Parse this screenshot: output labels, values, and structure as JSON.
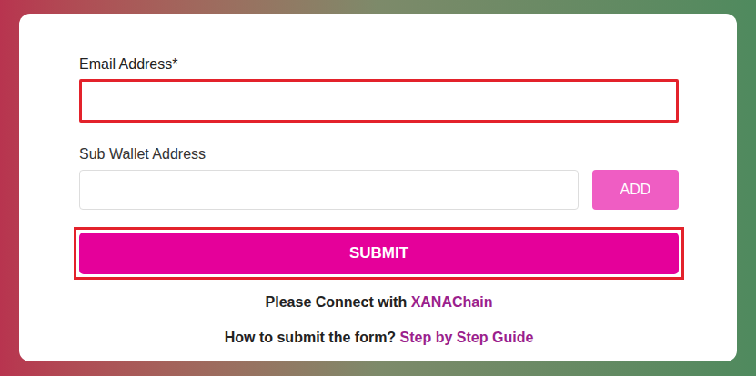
{
  "email_field": {
    "label": "Email Address*",
    "value": "",
    "highlighted": true
  },
  "sub_wallet_field": {
    "label": "Sub Wallet Address",
    "value": "",
    "highlighted": false,
    "button": "ADD"
  },
  "submit_button": {
    "label": "SUBMIT",
    "highlighted": true
  },
  "connect_note": {
    "text": "Please Connect with",
    "link": "XANAChain"
  },
  "guide_note": {
    "text": "How to submit the form?",
    "link": "Step by Step Guide"
  }
}
